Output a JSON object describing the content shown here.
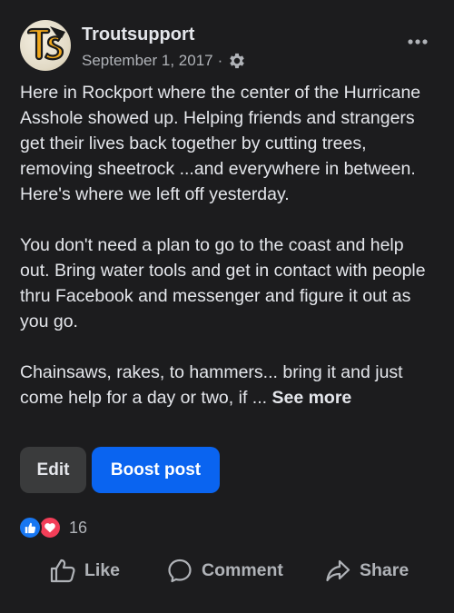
{
  "post": {
    "author": "Troutsupport",
    "avatar_text": "TS",
    "date": "September 1, 2017",
    "separator": "·",
    "privacy_icon": "gear-icon",
    "more_icon": "more-horizontal-icon",
    "paragraphs": [
      "Here in Rockport where the center of the Hurricane Asshole showed up. Helping friends and strangers get their lives back together by cutting trees, removing sheetrock ...and everywhere in between. Here's where we left off yesterday.",
      "You don't need a plan to go to the coast and help out. Bring water tools and get in contact with people thru Facebook and messenger and figure it out as you go."
    ],
    "truncated_text": "Chainsaws, rakes, to hammers... bring it and just come help for a day or two, if ...",
    "see_more_label": "See more"
  },
  "actions": {
    "edit_label": "Edit",
    "boost_label": "Boost post"
  },
  "reactions": {
    "icons": [
      "like-reaction-icon",
      "love-reaction-icon"
    ],
    "count": "16"
  },
  "footer": {
    "like_label": "Like",
    "comment_label": "Comment",
    "share_label": "Share"
  },
  "colors": {
    "background": "#1c1c1e",
    "text": "#e4e6eb",
    "secondary_text": "#b0b3b8",
    "boost_blue": "#0a64f0",
    "edit_button": "#3a3b3c",
    "like_blue": "#1877f2",
    "love_red": "#f33e58"
  }
}
